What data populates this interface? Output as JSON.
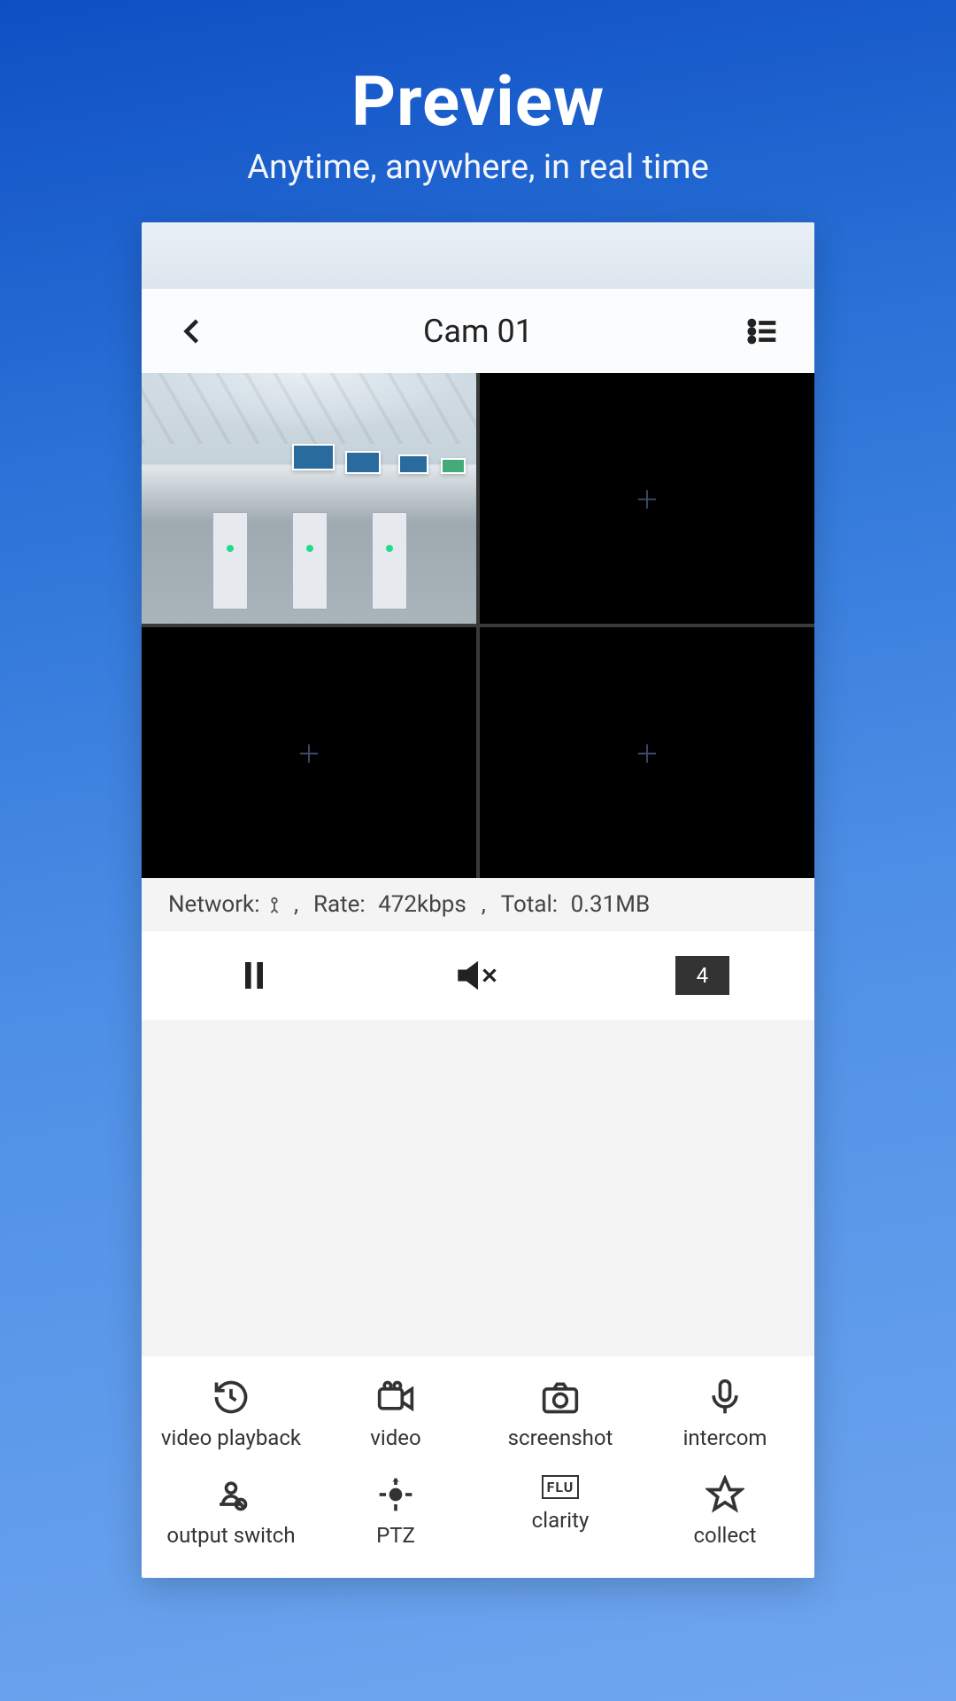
{
  "hero": {
    "title": "Preview",
    "subtitle": "Anytime, anywhere, in real time"
  },
  "appbar": {
    "title": "Cam 01"
  },
  "grid": {
    "selectedIndex": 0,
    "cells": [
      {
        "hasStream": true
      },
      {
        "hasStream": false
      },
      {
        "hasStream": false
      },
      {
        "hasStream": false
      }
    ]
  },
  "stats": {
    "networkLabel": "Network:",
    "rateLabel": "Rate:",
    "rateValue": "472kbps",
    "totalLabel": "Total:",
    "totalValue": "0.31MB"
  },
  "controls": {
    "layoutCount": "4"
  },
  "tools": {
    "t1": "video playback",
    "t2": "video",
    "t3": "screenshot",
    "t4": "intercom",
    "t5": "output switch",
    "t6": "PTZ",
    "t7": "clarity",
    "t7badge": "FLU",
    "t8": "collect"
  }
}
